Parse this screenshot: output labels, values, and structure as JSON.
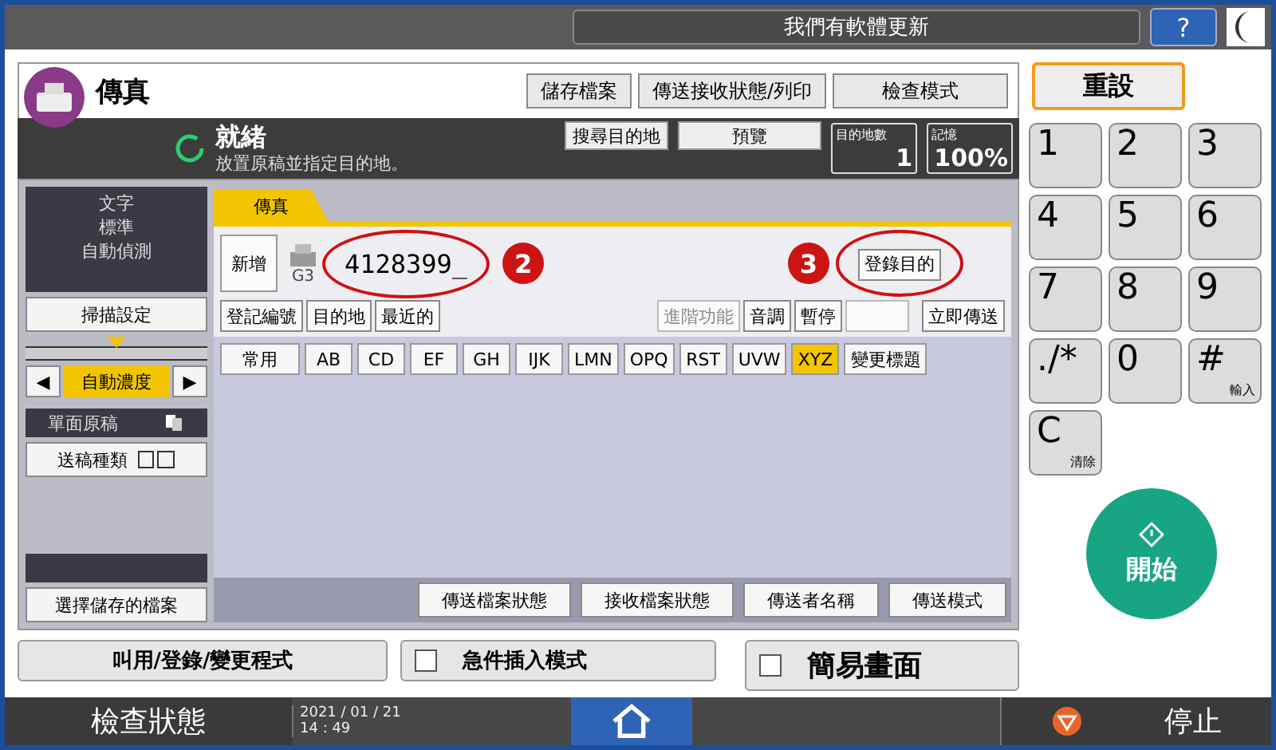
{
  "top_bar": {
    "notice": "我們有軟體更新",
    "help": "?"
  },
  "app": {
    "title": "傳真",
    "header_buttons": [
      "儲存檔案",
      "傳送接收狀態/列印",
      "檢查模式"
    ]
  },
  "status": {
    "title": "就緒",
    "message": "放置原稿並指定目的地。",
    "search_button": "搜尋目的地",
    "preview_button": "預覽",
    "counters": [
      {
        "label": "目的地數",
        "value": "1"
      },
      {
        "label": "記憶",
        "value": "100%"
      }
    ]
  },
  "settings": {
    "summary": [
      "文字",
      "標準",
      "自動偵測"
    ],
    "scan_button": "掃描設定",
    "density": {
      "level": 0.5,
      "label": "自動濃度",
      "left": "◀",
      "right": "▶"
    },
    "original_label": "單面原稿",
    "feed_button": "送稿種類",
    "stored_button": "選擇儲存的檔案"
  },
  "tab": {
    "label": "傳真",
    "selected": true
  },
  "destination": {
    "add_button": "新增",
    "line": "G3",
    "number": "4128399_",
    "register_button": "登錄目的"
  },
  "actions": [
    {
      "label": "登記編號",
      "disabled": false
    },
    {
      "label": "目的地",
      "disabled": false
    },
    {
      "label": "最近的",
      "disabled": false
    },
    {
      "label": "進階功能",
      "disabled": true
    },
    {
      "label": "音調",
      "disabled": false
    },
    {
      "label": "暫停",
      "disabled": false
    },
    {
      "label": "立即傳送",
      "disabled": false
    }
  ],
  "index_tabs": [
    {
      "label": "常用",
      "selected": false
    },
    {
      "label": "AB",
      "selected": false
    },
    {
      "label": "CD",
      "selected": false
    },
    {
      "label": "EF",
      "selected": false
    },
    {
      "label": "GH",
      "selected": false
    },
    {
      "label": "IJK",
      "selected": false
    },
    {
      "label": "LMN",
      "selected": false
    },
    {
      "label": "OPQ",
      "selected": false
    },
    {
      "label": "RST",
      "selected": false
    },
    {
      "label": "UVW",
      "selected": false
    },
    {
      "label": "XYZ",
      "selected": true
    },
    {
      "label": "變更標題",
      "selected": false
    }
  ],
  "bottom_buttons": [
    "傳送檔案狀態",
    "接收檔案狀態",
    "傳送者名稱",
    "傳送模式"
  ],
  "program_button": "叫用/登錄/變更程式",
  "toggles": [
    {
      "label": "急件插入模式",
      "checked": false
    },
    {
      "label": "簡易畫面",
      "checked": false
    }
  ],
  "annotations": [
    "2",
    "3"
  ],
  "reset_button": "重設",
  "keypad": [
    {
      "label": "1"
    },
    {
      "label": "2"
    },
    {
      "label": "3"
    },
    {
      "label": "4"
    },
    {
      "label": "5"
    },
    {
      "label": "6"
    },
    {
      "label": "7"
    },
    {
      "label": "8"
    },
    {
      "label": "9"
    },
    {
      "label": "./*"
    },
    {
      "label": "0"
    },
    {
      "label": "#",
      "sub": "輸入"
    },
    {
      "label": "C",
      "sub": "清除"
    }
  ],
  "start_button": "開始",
  "footer": {
    "check_status": "檢查狀態",
    "date": "2021 / 01 / 21",
    "time": "14 : 49",
    "stop": "停止"
  }
}
